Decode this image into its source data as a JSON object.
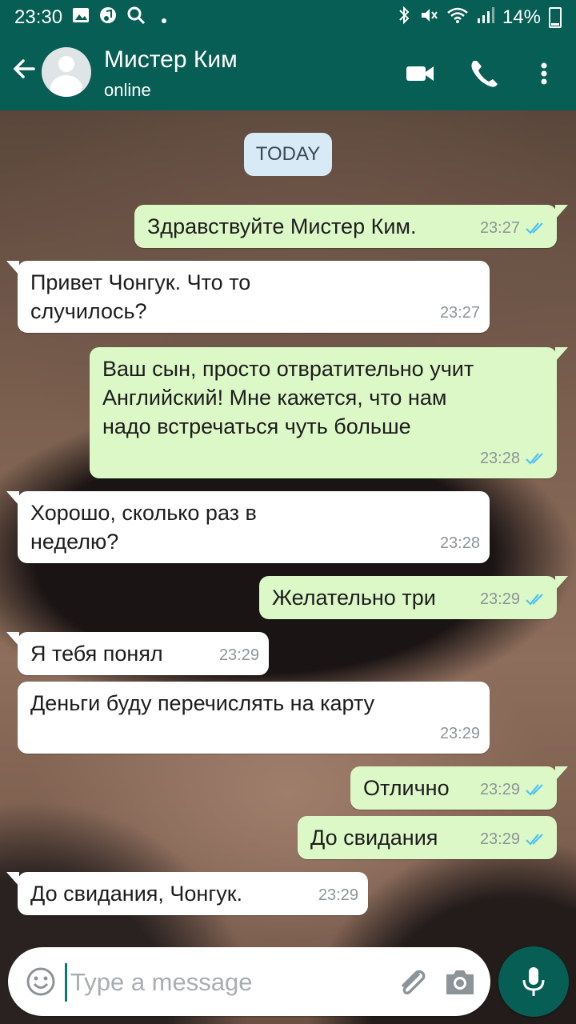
{
  "status_bar": {
    "time": "23:30",
    "battery": "14%",
    "left_icons": [
      "image-icon",
      "music-icon",
      "search-icon",
      "dot-icon"
    ],
    "right_icons": [
      "bluetooth-icon",
      "mute-icon",
      "wifi-icon",
      "signal-icon",
      "battery-icon"
    ]
  },
  "header": {
    "contact_name": "Мистер Ким",
    "status": "online"
  },
  "date_divider": "TODAY",
  "messages": [
    {
      "dir": "out",
      "text": "Здравствуйте Мистер Ким.",
      "time": "23:27",
      "read": true
    },
    {
      "dir": "in",
      "text": "Привет Чонгук. Что то случилось?",
      "time": "23:27"
    },
    {
      "dir": "out",
      "text": "Ваш сын, просто отвратительно учит Английский! Мне кажется, что нам надо встречаться чуть больше",
      "time": "23:28",
      "read": true
    },
    {
      "dir": "in",
      "text": "Хорошо, сколько раз в неделю?",
      "time": "23:28"
    },
    {
      "dir": "out",
      "text": "Желательно три",
      "time": "23:29",
      "read": true
    },
    {
      "dir": "in",
      "text": "Я тебя понял",
      "time": "23:29"
    },
    {
      "dir": "in",
      "text": "Деньги буду перечислять на карту",
      "time": "23:29"
    },
    {
      "dir": "out",
      "text": "Отлично",
      "time": "23:29",
      "read": true
    },
    {
      "dir": "out",
      "text": "До свидания",
      "time": "23:29",
      "read": true
    },
    {
      "dir": "in",
      "text": "До свидания, Чонгук.",
      "time": "23:29"
    }
  ],
  "input": {
    "placeholder": "Type a message"
  },
  "colors": {
    "brand": "#075e54",
    "outgoing_bubble": "#dcf8c6",
    "incoming_bubble": "#ffffff",
    "read_ticks": "#4fc3f7"
  }
}
